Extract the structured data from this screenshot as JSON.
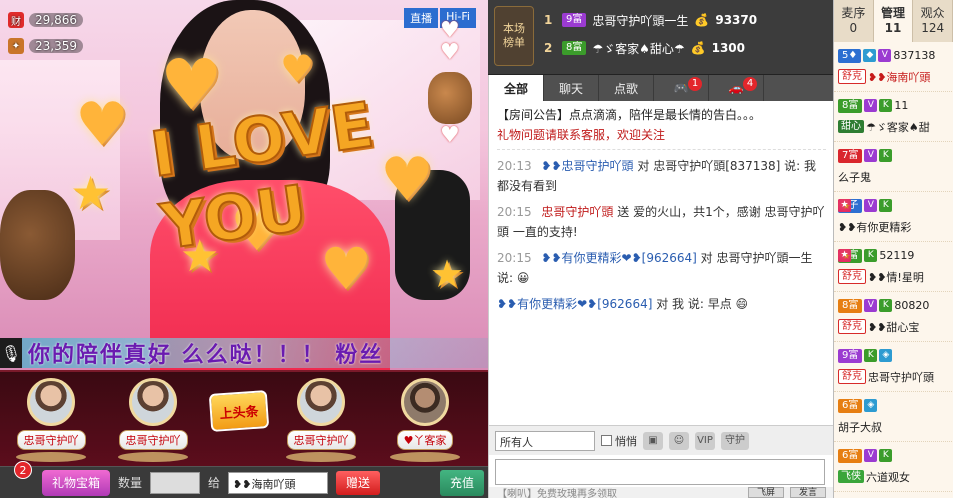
{
  "video": {
    "counters": [
      {
        "icon": "wealth-icon",
        "icon_text": "财",
        "value": "29,866"
      },
      {
        "icon": "gift-points-icon",
        "icon_text": "",
        "value": "23,359"
      }
    ],
    "badges": [
      "直播",
      "Hi-Fi"
    ],
    "overlay_text": "I LOVE YOU",
    "ticker_text": "你的陪伴真好 么么哒！！！ 粉丝"
  },
  "seats": [
    {
      "name": "忠哥守护吖"
    },
    {
      "name": "忠哥守护吖"
    },
    {
      "name": "忠哥守护吖"
    },
    {
      "name": "♥丫客家"
    }
  ],
  "headline_label": "上头条",
  "giftbar": {
    "badge_count": "2",
    "giftbox_label": "礼物宝箱",
    "qty_label": "数量",
    "to_label": "给",
    "to_value": "❥❥海南吖頭",
    "send_label": "赠送",
    "recharge_label": "充值"
  },
  "rank": {
    "tab_label_1": "本场",
    "tab_label_2": "榜单",
    "rows": [
      {
        "num": "1",
        "level": "9富",
        "name": "忠哥守护吖頭一生",
        "amount": "93370"
      },
      {
        "num": "2",
        "level": "8富",
        "name": "☂ゞ客家♠甜心☂",
        "amount": "1300"
      }
    ]
  },
  "chat": {
    "tabs": [
      {
        "label": "全部",
        "badge": ""
      },
      {
        "label": "聊天",
        "badge": ""
      },
      {
        "label": "点歌",
        "badge": ""
      },
      {
        "label": "🎮",
        "badge": "1"
      },
      {
        "label": "🚗",
        "badge": "4"
      }
    ],
    "system_msg": "【房间公告】点点滴滴，陪伴是最长情的告白。。。",
    "system_warn": "礼物问题请联系客服，欢迎关注",
    "lines": [
      {
        "time": "20:13",
        "user": "❥❥忠哥守护吖頭",
        "text": "对 忠哥守护吖頭[837138] 说: 我都没有看到"
      },
      {
        "time": "20:15",
        "user": "忠哥守护吖頭",
        "text": "送 爱的火山，共1个，感谢 忠哥守护吖頭 一直的支持!"
      },
      {
        "time": "20:15",
        "user": "❥❥有你更精彩❤❥[962664]",
        "text": "对 忠哥守护吖頭一生 说: 😀"
      },
      {
        "time": "",
        "user": "❥❥有你更精彩❤❥[962664]",
        "text": "对 我 说: 早点 😄"
      }
    ],
    "target_select": "所有人",
    "private_label": "悄悄",
    "vip_label": "VIP",
    "guard_label": "守护",
    "footer_tip": "【喇叭】免费玫瑰再多领取",
    "fly_label": "飞屏",
    "send_label": "发言"
  },
  "users": {
    "tabs": [
      {
        "label": "麦序",
        "count": "0"
      },
      {
        "label": "管理",
        "count": "11"
      },
      {
        "label": "观众",
        "count": "124"
      }
    ],
    "items": [
      {
        "level": "5♦",
        "tag": "舒克",
        "id": "837138",
        "nick": "❥❥海南吖頭"
      },
      {
        "level": "8富",
        "tag": "甜心",
        "id": "11",
        "nick": "☂ゞ客家♠甜"
      },
      {
        "level": "7富",
        "tag": "",
        "id": "",
        "nick": "么子鬼"
      },
      {
        "level": "9子",
        "tag": "",
        "id": "",
        "nick": "❥❥有你更精彩"
      },
      {
        "level": "8富",
        "tag": "舒克",
        "id": "52119",
        "nick": "❥❥情!星明"
      },
      {
        "level": "8富",
        "tag": "舒克",
        "id": "80820",
        "nick": "❥❥甜心宝"
      },
      {
        "level": "9富",
        "tag": "舒克",
        "id": "",
        "nick": "忠哥守护吖頭"
      },
      {
        "level": "6富",
        "tag": "",
        "id": "",
        "nick": "胡子大叔"
      },
      {
        "level": "6富",
        "tag": "飞侠",
        "id": "",
        "nick": "六道观女"
      }
    ]
  },
  "colors": {
    "accent": "#f5a623",
    "chat_bg": "#ffffff",
    "panel_dark": "#3c3c3c",
    "ticker_text": "#6a1bb0"
  }
}
